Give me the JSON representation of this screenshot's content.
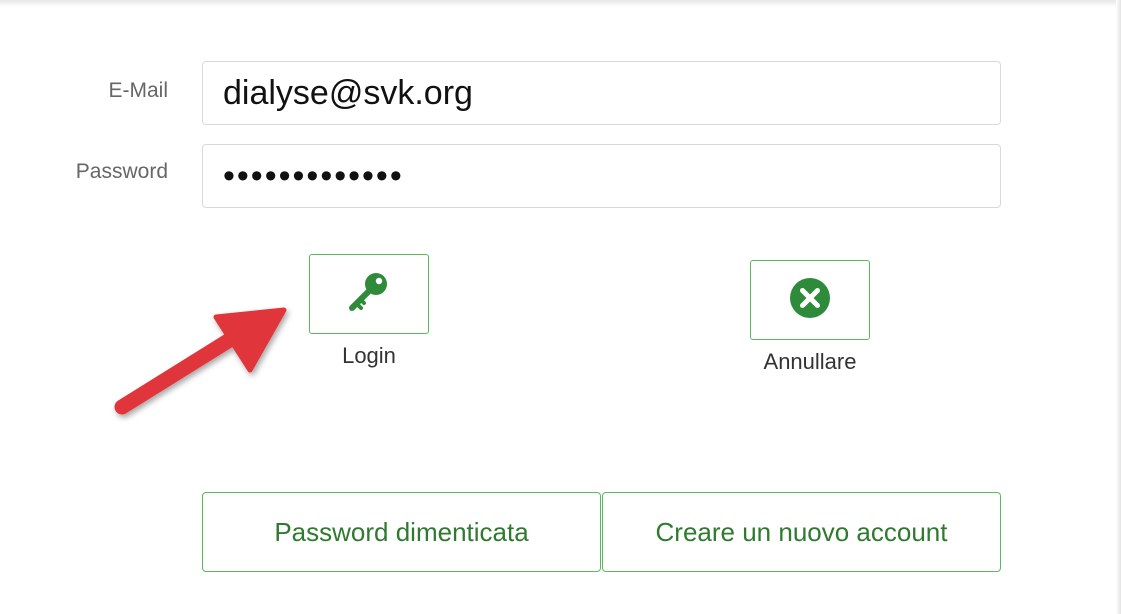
{
  "form": {
    "email_label": "E-Mail",
    "email_value": "dialyse@svk.org",
    "password_label": "Password",
    "password_value": "•••••••••••••"
  },
  "actions": {
    "login_label": "Login",
    "login_icon": "key-icon",
    "cancel_label": "Annullare",
    "cancel_icon": "close-circle-icon",
    "forgot_password_label": "Password dimenticata",
    "create_account_label": "Creare un nuovo account"
  },
  "colors": {
    "accent_green": "#5cb85c",
    "icon_green": "#2e8b3a",
    "annotation_arrow": "#e0363b"
  }
}
